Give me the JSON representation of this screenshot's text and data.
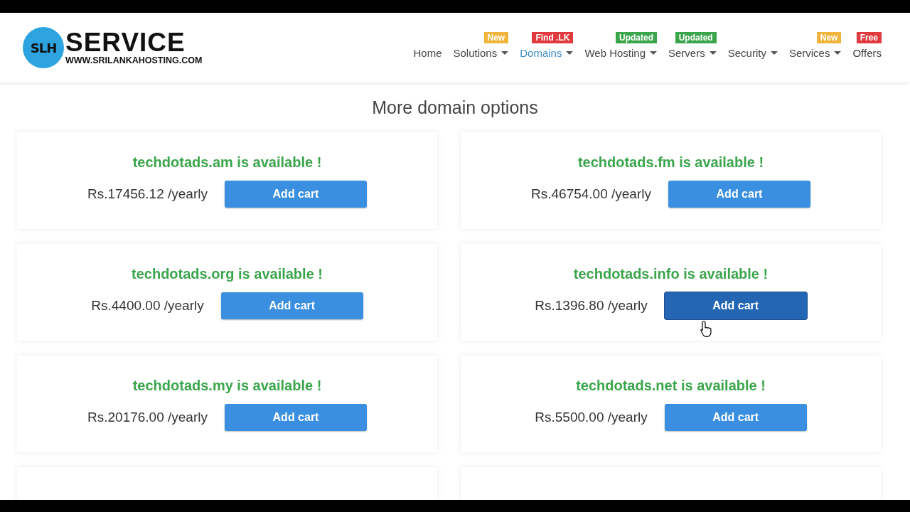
{
  "logo": {
    "mark": "SLH",
    "name": "SERVICE",
    "url": "WWW.SRILANKAHOSTING.COM"
  },
  "nav": [
    {
      "label": "Home",
      "selected": false,
      "has_menu": false
    },
    {
      "label": "Solutions",
      "selected": false,
      "has_menu": true,
      "badge": {
        "text": "New",
        "color": "#f0b43c"
      }
    },
    {
      "label": "Domains",
      "selected": true,
      "has_menu": true,
      "badge": {
        "text": "Find .LK",
        "color": "#e0393e"
      }
    },
    {
      "label": "Web Hosting",
      "selected": false,
      "has_menu": true,
      "badge": {
        "text": "Updated",
        "color": "#3aa54b"
      }
    },
    {
      "label": "Servers",
      "selected": false,
      "has_menu": true,
      "badge": {
        "text": "Updated",
        "color": "#3aa54b"
      }
    },
    {
      "label": "Security",
      "selected": false,
      "has_menu": true
    },
    {
      "label": "Services",
      "selected": false,
      "has_menu": true,
      "badge": {
        "text": "New",
        "color": "#f0b43c"
      }
    },
    {
      "label": "Offers",
      "selected": false,
      "has_menu": false,
      "badge": {
        "text": "Free",
        "color": "#e0393e"
      }
    }
  ],
  "heading": "More domain options",
  "results": [
    {
      "status": "techdotads.am is available !",
      "price": "Rs.17456.12 /yearly",
      "button": "Add cart",
      "hovered": false
    },
    {
      "status": "techdotads.fm is available !",
      "price": "Rs.46754.00 /yearly",
      "button": "Add cart",
      "hovered": false
    },
    {
      "status": "techdotads.org is available !",
      "price": "Rs.4400.00 /yearly",
      "button": "Add cart",
      "hovered": false
    },
    {
      "status": "techdotads.info is available !",
      "price": "Rs.1396.80 /yearly",
      "button": "Add cart",
      "hovered": true
    },
    {
      "status": "techdotads.my is available !",
      "price": "Rs.20176.00 /yearly",
      "button": "Add cart",
      "hovered": false
    },
    {
      "status": "techdotads.net is available !",
      "price": "Rs.5500.00 /yearly",
      "button": "Add cart",
      "hovered": false
    },
    {
      "partial": true
    },
    {
      "partial": true
    }
  ]
}
